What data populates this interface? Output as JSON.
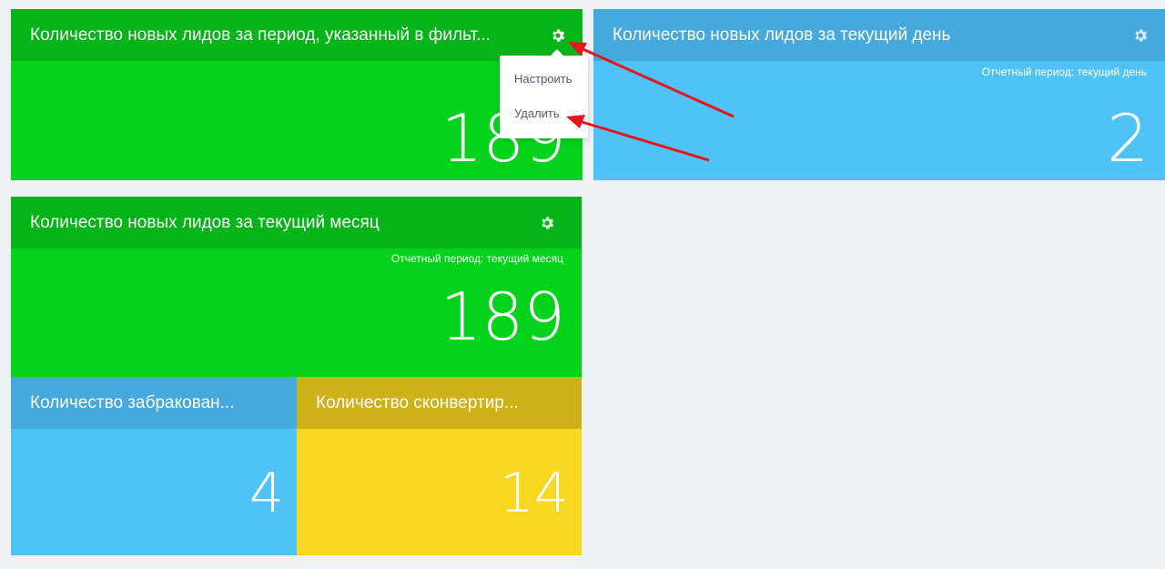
{
  "widgets": {
    "w1": {
      "title": "Количество новых лидов за период, указанный в фильт...",
      "value": "189"
    },
    "w2": {
      "title": "Количество новых лидов за текущий день",
      "period": "Отчетный период: текущий день",
      "value": "2"
    },
    "w3": {
      "title": "Количество новых лидов за текущий месяц",
      "period": "Отчетный период: текущий месяц",
      "value": "189"
    },
    "w4": {
      "title": "Количество забракован...",
      "value": "4"
    },
    "w5": {
      "title": "Количество сконвертир...",
      "value": "14"
    }
  },
  "menu": {
    "configure": "Настроить",
    "delete": "Удалить"
  },
  "icons": {
    "settings": "gear-icon"
  },
  "colors": {
    "green": "#05d31b",
    "green_header": "#04b418",
    "blue": "#4fc3f7",
    "blue_header": "#45a9db",
    "yellow": "#f8d722",
    "yellow_header": "#cfb11a",
    "annotation_arrow": "#e8141c",
    "background": "#eef2f4"
  }
}
